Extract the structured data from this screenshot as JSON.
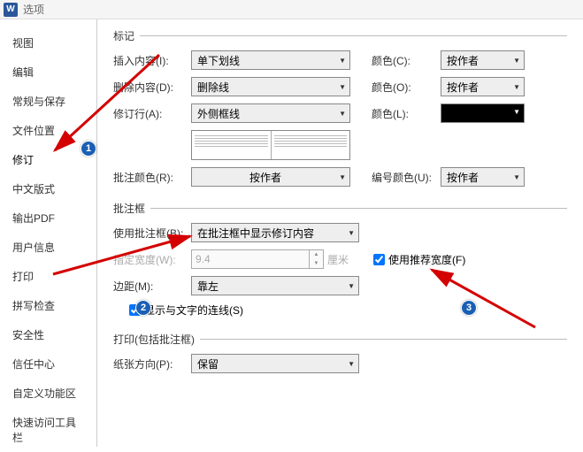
{
  "window": {
    "title": "选项",
    "icon": "W"
  },
  "sidebar": {
    "items": [
      {
        "label": "视图"
      },
      {
        "label": "编辑"
      },
      {
        "label": "常规与保存"
      },
      {
        "label": "文件位置"
      },
      {
        "label": "修订"
      },
      {
        "label": "中文版式"
      },
      {
        "label": "输出PDF"
      },
      {
        "label": "用户信息"
      },
      {
        "label": "打印"
      },
      {
        "label": "拼写检查"
      },
      {
        "label": "安全性"
      },
      {
        "label": "信任中心"
      },
      {
        "label": "自定义功能区"
      },
      {
        "label": "快速访问工具栏"
      }
    ],
    "active_index": 4
  },
  "marks": {
    "legend": "标记",
    "insert": {
      "label": "插入内容(I):",
      "value": "单下划线",
      "color_label": "颜色(C):",
      "color_value": "按作者"
    },
    "delete": {
      "label": "删除内容(D):",
      "value": "删除线",
      "color_label": "颜色(O):",
      "color_value": "按作者"
    },
    "revise": {
      "label": "修订行(A):",
      "value": "外侧框线",
      "color_label": "颜色(L):"
    },
    "annot_color": {
      "label": "批注颜色(R):",
      "value": "按作者",
      "num_label": "编号颜色(U):",
      "num_value": "按作者"
    }
  },
  "balloon": {
    "legend": "批注框",
    "use": {
      "label": "使用批注框(B):",
      "value": "在批注框中显示修订内容"
    },
    "width": {
      "label": "指定宽度(W):",
      "value": "9.4",
      "unit": "厘米"
    },
    "recommended": {
      "label": "使用推荐宽度(F)",
      "checked": true
    },
    "margin": {
      "label": "边距(M):",
      "value": "靠左"
    },
    "connector": {
      "label": "显示与文字的连线(S)",
      "checked": true
    }
  },
  "print": {
    "legend": "打印(包括批注框)",
    "orient": {
      "label": "纸张方向(P):",
      "value": "保留"
    }
  },
  "badges": {
    "b1": "1",
    "b2": "2",
    "b3": "3"
  }
}
